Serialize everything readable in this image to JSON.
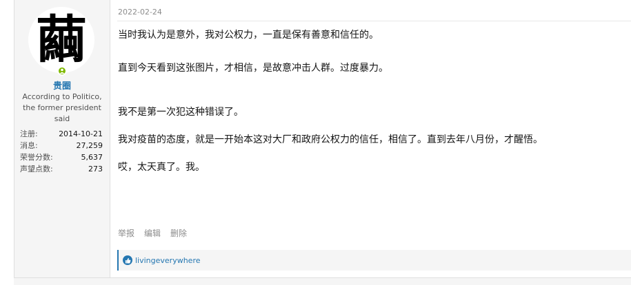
{
  "user": {
    "avatar_glyph": "繭",
    "name": "贵圈",
    "title": "According to Politico, the former president said",
    "stats": [
      {
        "label": "注册:",
        "value": "2014-10-21"
      },
      {
        "label": "消息:",
        "value": "27,259"
      },
      {
        "label": "荣誉分数:",
        "value": "5,637"
      },
      {
        "label": "声望点数:",
        "value": "273"
      }
    ]
  },
  "post": {
    "date": "2022-02-24",
    "lines": [
      "当时我认为是意外，我对公权力，一直是保有善意和信任的。",
      "直到今天看到这张图片，才相信，是故意冲击人群。过度暴力。",
      "我不是第一次犯这种错误了。",
      "我对疫苗的态度，就是一开始本这对大厂和政府公权力的信任，相信了。直到去年八月份，才醒悟。",
      "哎，太天真了。我。"
    ],
    "actions": {
      "report": "举报",
      "edit": "编辑",
      "delete": "删除"
    },
    "reaction_user": "livingeverywhere"
  },
  "colors": {
    "accent": "#2577b1",
    "online": "#7fb900",
    "sidebar_bg": "#f5f5f5"
  }
}
